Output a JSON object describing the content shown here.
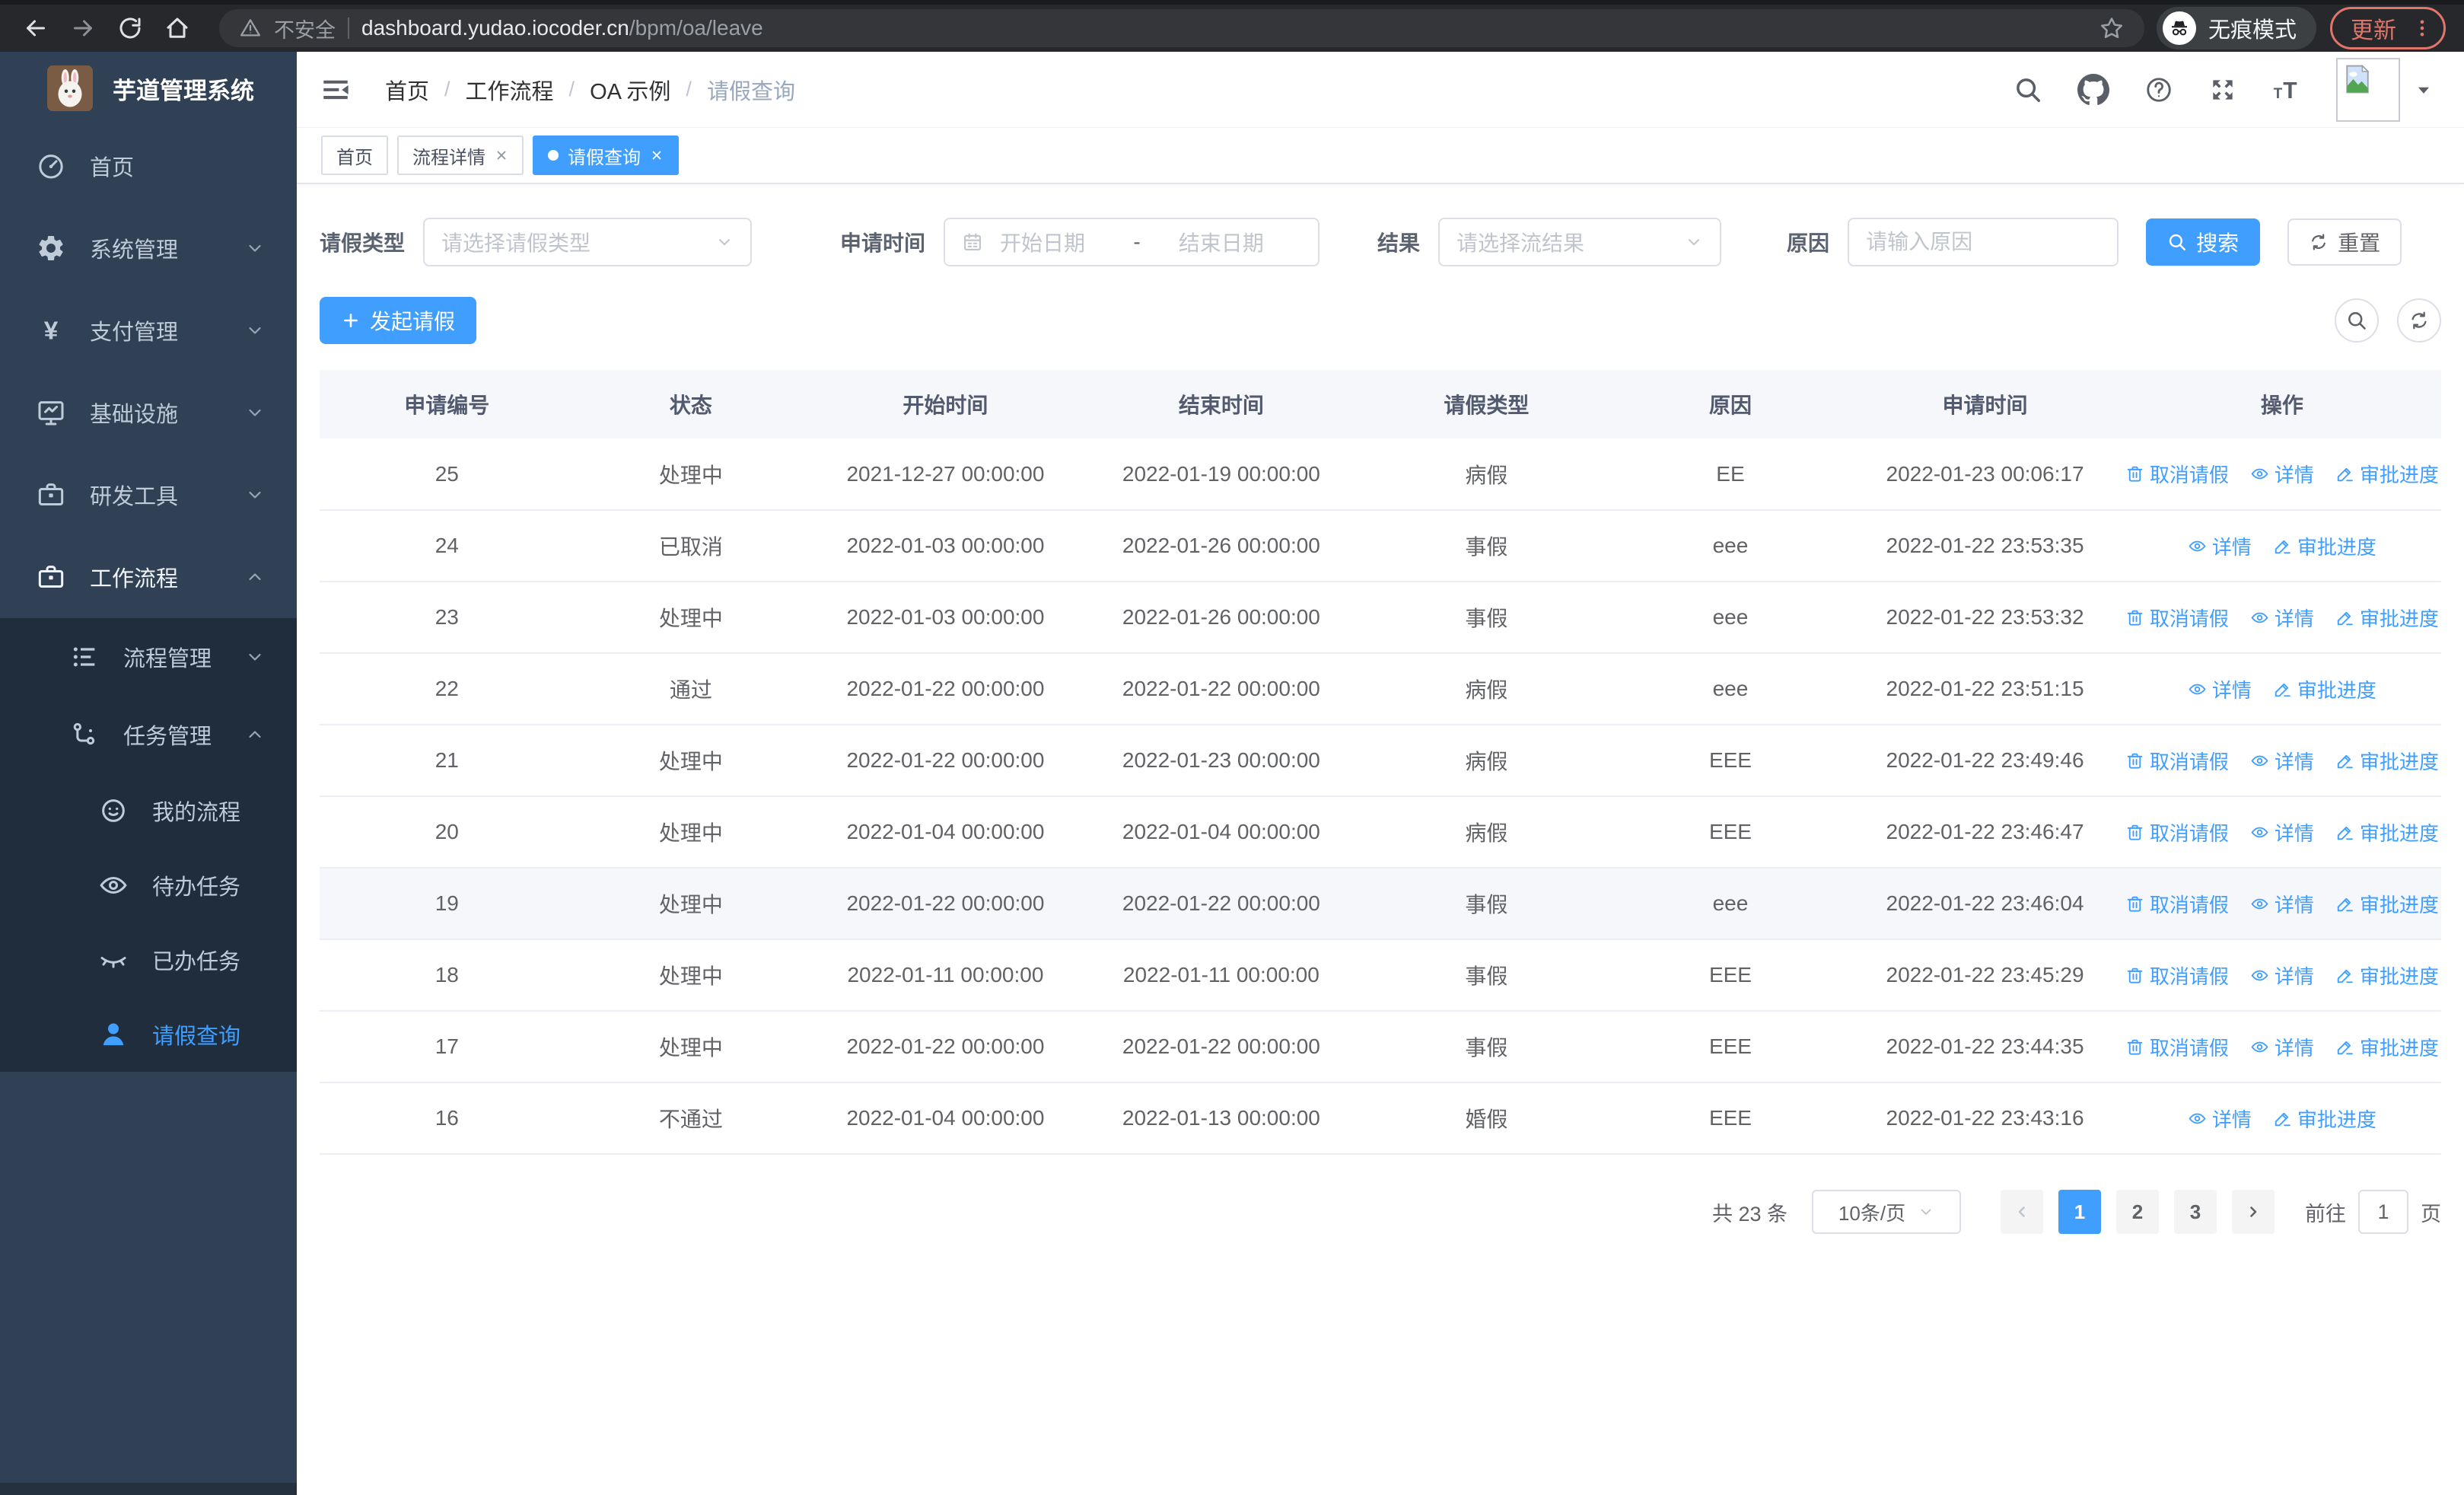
{
  "browser": {
    "security_label": "不安全",
    "url_host": "dashboard.yudao.iocoder.cn",
    "url_path": "/bpm/oa/leave",
    "incognito_label": "无痕模式",
    "update_label": "更新"
  },
  "sidebar": {
    "title": "芋道管理系统",
    "items": [
      {
        "key": "home",
        "label": "首页",
        "icon": "dashboard"
      },
      {
        "key": "system",
        "label": "系统管理",
        "icon": "gear",
        "arrow": "down"
      },
      {
        "key": "payment",
        "label": "支付管理",
        "icon": "yen",
        "arrow": "down"
      },
      {
        "key": "infra",
        "label": "基础设施",
        "icon": "monitor",
        "arrow": "down"
      },
      {
        "key": "devtools",
        "label": "研发工具",
        "icon": "toolbox",
        "arrow": "down"
      },
      {
        "key": "workflow",
        "label": "工作流程",
        "icon": "briefcase",
        "arrow": "up",
        "emphasis": true,
        "children": [
          {
            "key": "process-mgmt",
            "label": "流程管理",
            "icon": "list",
            "arrow": "down"
          },
          {
            "key": "task-mgmt",
            "label": "任务管理",
            "icon": "flow",
            "arrow": "up",
            "children": [
              {
                "key": "my-process",
                "label": "我的流程",
                "icon": "face"
              },
              {
                "key": "todo-tasks",
                "label": "待办任务",
                "icon": "eye"
              },
              {
                "key": "done-tasks",
                "label": "已办任务",
                "icon": "eye-closed"
              },
              {
                "key": "leave-query",
                "label": "请假查询",
                "icon": "user",
                "active": true
              }
            ]
          }
        ]
      }
    ]
  },
  "header": {
    "breadcrumb": {
      "items": [
        "首页",
        "工作流程",
        "OA 示例",
        "请假查询"
      ],
      "separator": "/"
    }
  },
  "tabs": [
    {
      "key": "home",
      "label": "首页",
      "active": false,
      "closable": false
    },
    {
      "key": "process-detail",
      "label": "流程详情",
      "active": false,
      "closable": true
    },
    {
      "key": "leave-query",
      "label": "请假查询",
      "active": true,
      "closable": true
    }
  ],
  "filters": {
    "leave_type_label": "请假类型",
    "leave_type_placeholder": "请选择请假类型",
    "apply_time_label": "申请时间",
    "date_start_placeholder": "开始日期",
    "date_separator": "-",
    "date_end_placeholder": "结束日期",
    "result_label": "结果",
    "result_placeholder": "请选择流结果",
    "reason_label": "原因",
    "reason_placeholder": "请输入原因",
    "search_label": "搜索",
    "reset_label": "重置"
  },
  "toolbar": {
    "create_label": "发起请假"
  },
  "table": {
    "headers": [
      "申请编号",
      "状态",
      "开始时间",
      "结束时间",
      "请假类型",
      "原因",
      "申请时间",
      "操作"
    ],
    "action_labels": {
      "cancel": "取消请假",
      "detail": "详情",
      "progress": "审批进度"
    },
    "rows": [
      {
        "id": "25",
        "status": "处理中",
        "start": "2021-12-27 00:00:00",
        "end": "2022-01-19 00:00:00",
        "type": "病假",
        "reason": "EE",
        "applied": "2022-01-23 00:06:17",
        "actions": [
          "cancel",
          "detail",
          "progress"
        ],
        "highlighted": false
      },
      {
        "id": "24",
        "status": "已取消",
        "start": "2022-01-03 00:00:00",
        "end": "2022-01-26 00:00:00",
        "type": "事假",
        "reason": "eee",
        "applied": "2022-01-22 23:53:35",
        "actions": [
          "detail",
          "progress"
        ],
        "highlighted": false
      },
      {
        "id": "23",
        "status": "处理中",
        "start": "2022-01-03 00:00:00",
        "end": "2022-01-26 00:00:00",
        "type": "事假",
        "reason": "eee",
        "applied": "2022-01-22 23:53:32",
        "actions": [
          "cancel",
          "detail",
          "progress"
        ],
        "highlighted": false
      },
      {
        "id": "22",
        "status": "通过",
        "start": "2022-01-22 00:00:00",
        "end": "2022-01-22 00:00:00",
        "type": "病假",
        "reason": "eee",
        "applied": "2022-01-22 23:51:15",
        "actions": [
          "detail",
          "progress"
        ],
        "highlighted": false
      },
      {
        "id": "21",
        "status": "处理中",
        "start": "2022-01-22 00:00:00",
        "end": "2022-01-23 00:00:00",
        "type": "病假",
        "reason": "EEE",
        "applied": "2022-01-22 23:49:46",
        "actions": [
          "cancel",
          "detail",
          "progress"
        ],
        "highlighted": false
      },
      {
        "id": "20",
        "status": "处理中",
        "start": "2022-01-04 00:00:00",
        "end": "2022-01-04 00:00:00",
        "type": "病假",
        "reason": "EEE",
        "applied": "2022-01-22 23:46:47",
        "actions": [
          "cancel",
          "detail",
          "progress"
        ],
        "highlighted": false
      },
      {
        "id": "19",
        "status": "处理中",
        "start": "2022-01-22 00:00:00",
        "end": "2022-01-22 00:00:00",
        "type": "事假",
        "reason": "eee",
        "applied": "2022-01-22 23:46:04",
        "actions": [
          "cancel",
          "detail",
          "progress"
        ],
        "highlighted": true
      },
      {
        "id": "18",
        "status": "处理中",
        "start": "2022-01-11 00:00:00",
        "end": "2022-01-11 00:00:00",
        "type": "事假",
        "reason": "EEE",
        "applied": "2022-01-22 23:45:29",
        "actions": [
          "cancel",
          "detail",
          "progress"
        ],
        "highlighted": false
      },
      {
        "id": "17",
        "status": "处理中",
        "start": "2022-01-22 00:00:00",
        "end": "2022-01-22 00:00:00",
        "type": "事假",
        "reason": "EEE",
        "applied": "2022-01-22 23:44:35",
        "actions": [
          "cancel",
          "detail",
          "progress"
        ],
        "highlighted": false
      },
      {
        "id": "16",
        "status": "不通过",
        "start": "2022-01-04 00:00:00",
        "end": "2022-01-13 00:00:00",
        "type": "婚假",
        "reason": "EEE",
        "applied": "2022-01-22 23:43:16",
        "actions": [
          "detail",
          "progress"
        ],
        "highlighted": false
      }
    ]
  },
  "pagination": {
    "total_text": "共 23 条",
    "page_size_value": "10条/页",
    "pages": [
      "1",
      "2",
      "3"
    ],
    "active_page": "1",
    "prev_disabled": true,
    "goto_label": "前往",
    "goto_value": "1",
    "goto_suffix": "页"
  },
  "colors": {
    "accent": "#409eff",
    "link": "#409eff",
    "sidebar_bg": "#304156",
    "submenu_bg": "#1f2d3d",
    "table_header_bg": "#f6f7fb",
    "row_highlight": "#f5f7fa",
    "update_accent": "#e0766b"
  }
}
